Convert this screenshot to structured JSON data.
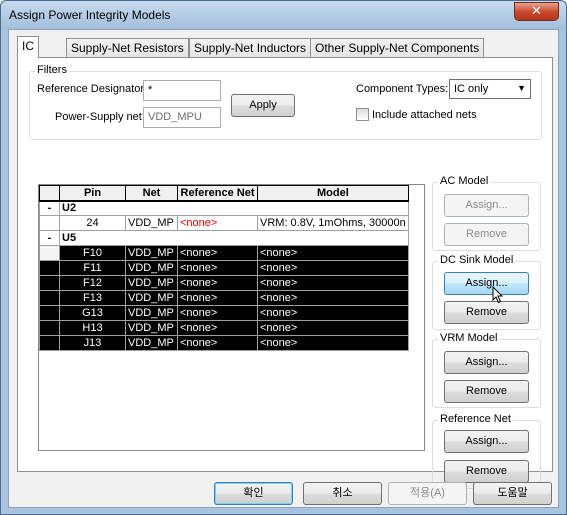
{
  "window": {
    "title": "Assign Power Integrity Models",
    "close_glyph": "✕"
  },
  "tabs": [
    {
      "label": "IC"
    },
    {
      "label": "Supply-Net Resistors"
    },
    {
      "label": "Supply-Net Inductors"
    },
    {
      "label": "Other Supply-Net Components"
    }
  ],
  "filters": {
    "title": "Filters",
    "ref_designator_label": "Reference Designator:",
    "ref_designator_value": "*",
    "power_supply_label": "Power-Supply net:",
    "power_supply_value": "VDD_MPU",
    "apply_label": "Apply",
    "component_types_label": "Component Types:",
    "component_types_value": "IC only",
    "include_nets_label": "Include attached nets"
  },
  "grid": {
    "columns": [
      "Pin",
      "Net",
      "Reference Net",
      "Model"
    ],
    "groups": [
      {
        "expander": "-",
        "name": "U2",
        "rows": [
          {
            "pin": "24",
            "net": "VDD_MP",
            "ref_net": "<none>",
            "model": "VRM: 0.8V, 1mOhms, 30000n",
            "selected": false
          }
        ]
      },
      {
        "expander": "-",
        "name": "U5",
        "rows": [
          {
            "pin": "F10",
            "net": "VDD_MP",
            "ref_net": "<none>",
            "model": "<none>",
            "selected": true
          },
          {
            "pin": "F11",
            "net": "VDD_MP",
            "ref_net": "<none>",
            "model": "<none>",
            "selected": true
          },
          {
            "pin": "F12",
            "net": "VDD_MP",
            "ref_net": "<none>",
            "model": "<none>",
            "selected": true
          },
          {
            "pin": "F13",
            "net": "VDD_MP",
            "ref_net": "<none>",
            "model": "<none>",
            "selected": true
          },
          {
            "pin": "G13",
            "net": "VDD_MP",
            "ref_net": "<none>",
            "model": "<none>",
            "selected": true
          },
          {
            "pin": "H13",
            "net": "VDD_MP",
            "ref_net": "<none>",
            "model": "<none>",
            "selected": true
          },
          {
            "pin": "J13",
            "net": "VDD_MP",
            "ref_net": "<none>",
            "model": "<none>",
            "selected": true
          }
        ]
      }
    ]
  },
  "ac_model": {
    "title": "AC Model",
    "assign_label": "Assign...",
    "remove_label": "Remove"
  },
  "dc_sink_model": {
    "title": "DC Sink Model",
    "assign_label": "Assign...",
    "remove_label": "Remove"
  },
  "vrm_model": {
    "title": "VRM Model",
    "assign_label": "Assign...",
    "remove_label": "Remove"
  },
  "reference_net": {
    "title": "Reference Net",
    "assign_label": "Assign...",
    "remove_label": "Remove"
  },
  "footer": {
    "ok_label": "확인",
    "cancel_label": "취소",
    "apply_label": "적용(A)",
    "help_label": "도움말"
  },
  "colors": {
    "title_bar": "#a9c3de",
    "selection": "#000000",
    "none_text": "#e00000"
  }
}
